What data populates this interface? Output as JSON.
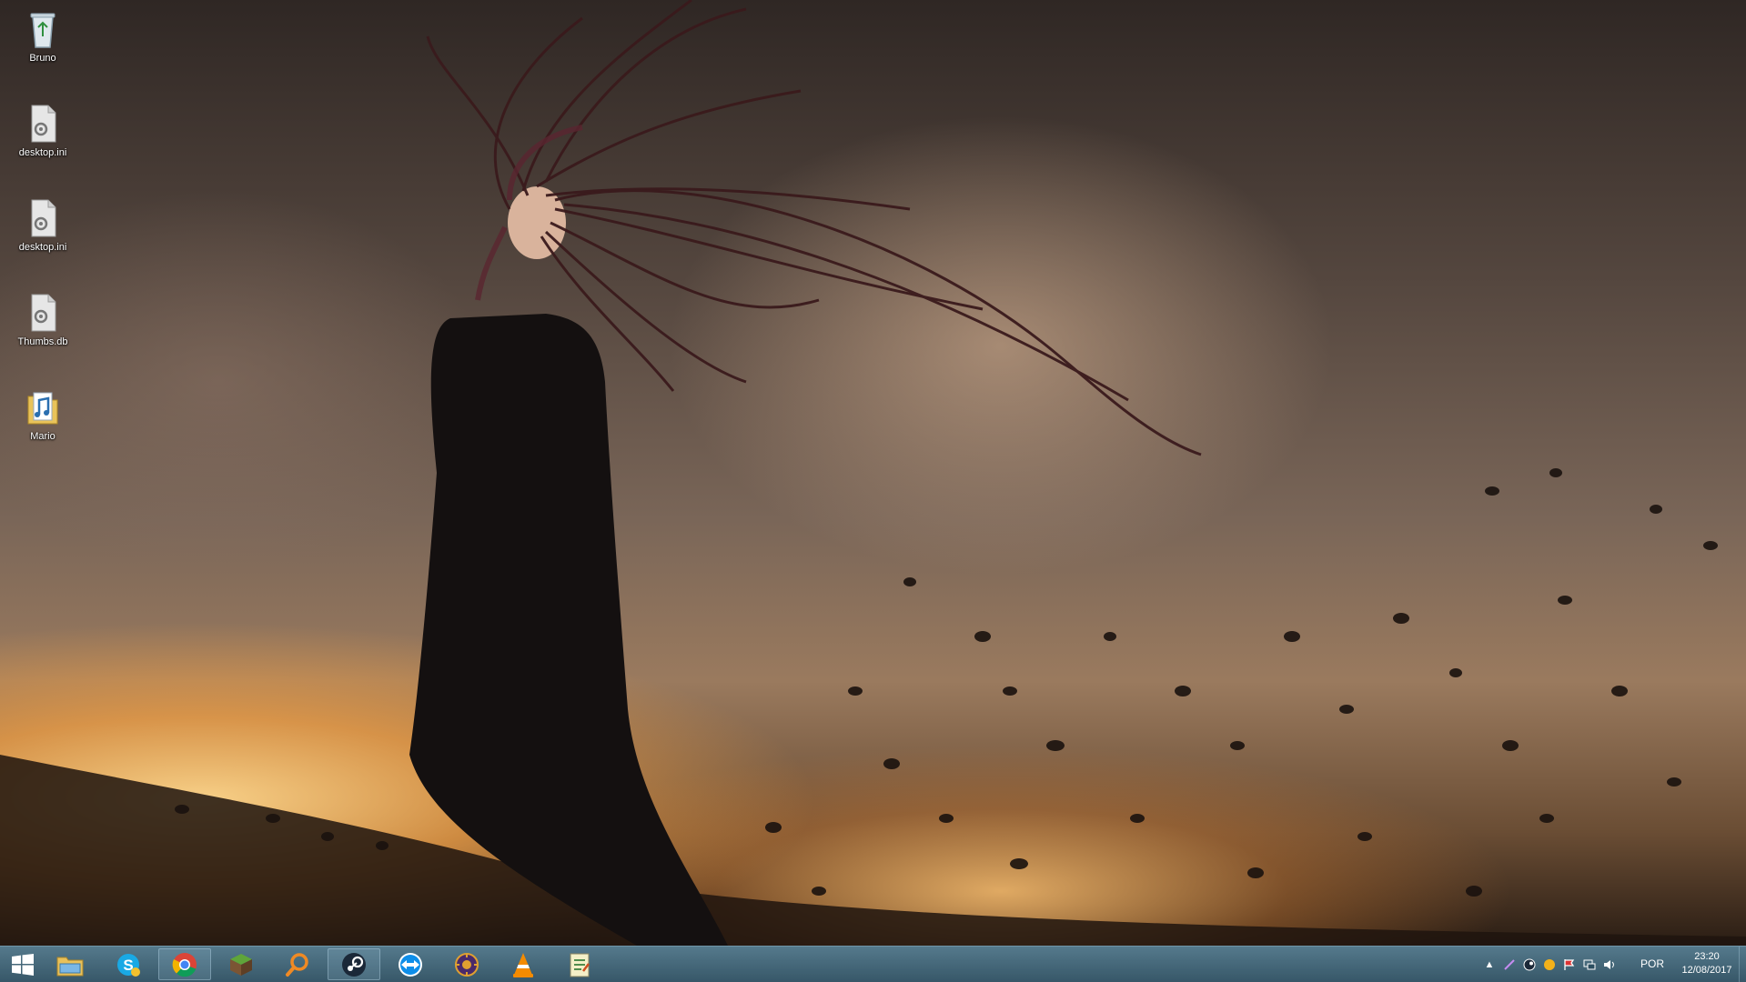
{
  "desktop": {
    "icons": [
      {
        "label": "Bruno",
        "icon": "recycle-bin-icon"
      },
      {
        "label": "desktop.ini",
        "icon": "settings-file-icon"
      },
      {
        "label": "desktop.ini",
        "icon": "settings-file-icon"
      },
      {
        "label": "Thumbs.db",
        "icon": "settings-file-icon"
      },
      {
        "label": "Mario",
        "icon": "music-folder-icon"
      }
    ]
  },
  "taskbar": {
    "pinned": [
      {
        "icon": "file-explorer-icon"
      },
      {
        "icon": "skype-icon"
      },
      {
        "icon": "chrome-icon",
        "active": true
      },
      {
        "icon": "minecraft-icon"
      },
      {
        "icon": "search-magnifier-icon"
      },
      {
        "icon": "steam-icon",
        "active": true
      },
      {
        "icon": "teamviewer-icon"
      },
      {
        "icon": "game-launcher-icon"
      },
      {
        "icon": "vlc-icon"
      },
      {
        "icon": "notepad-app-icon"
      }
    ],
    "tray": {
      "language": "POR",
      "time": "23:20",
      "date": "12/08/2017"
    }
  },
  "colors": {
    "taskbar": "#2c4e60",
    "sky_glow": "#f0a046"
  }
}
